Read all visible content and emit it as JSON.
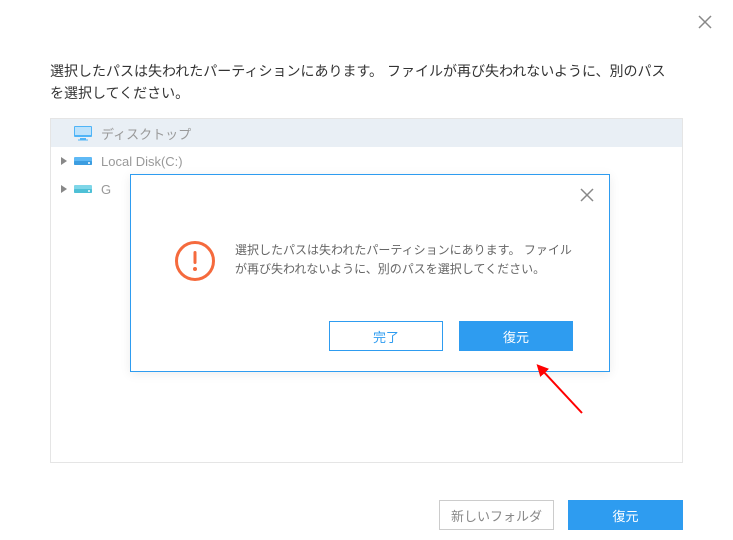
{
  "header": {
    "close_aria": "close"
  },
  "instruction_text": "選択したパスは失われたパーティションにあります。 ファイルが再び失われないように、別のパスを選択してください。",
  "tree": {
    "items": [
      {
        "label": "ディスクトップ",
        "icon": "monitor",
        "selected": true,
        "expandable": false
      },
      {
        "label": "Local Disk(C:)",
        "icon": "disk-blue",
        "selected": false,
        "expandable": true
      },
      {
        "label": "G",
        "icon": "disk-cyan",
        "selected": false,
        "expandable": true
      }
    ]
  },
  "footer": {
    "new_folder_label": "新しいフォルダ",
    "restore_label": "復元"
  },
  "alert": {
    "message": "選択したパスは失われたパーティションにあります。 ファイルが再び失われないように、別のパスを選択してください。",
    "done_label": "完了",
    "restore_label": "復元"
  },
  "colors": {
    "accent": "#2e9cf0",
    "warning": "#f56a3d"
  }
}
